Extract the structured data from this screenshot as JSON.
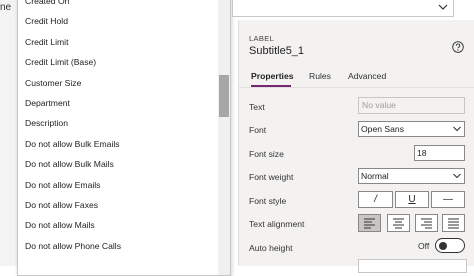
{
  "canvas": {
    "label_fragment": "ne"
  },
  "field_list": {
    "items": [
      "Created On",
      "Credit Hold",
      "Credit Limit",
      "Credit Limit (Base)",
      "Customer Size",
      "Department",
      "Description",
      "Do not allow Bulk Emails",
      "Do not allow Bulk Mails",
      "Do not allow Emails",
      "Do not allow Faxes",
      "Do not allow Mails",
      "Do not allow Phone Calls"
    ]
  },
  "panel": {
    "control_type": "LABEL",
    "control_name": "Subtitle5_1",
    "help_icon": "question-circle-icon",
    "tabs": [
      "Properties",
      "Rules",
      "Advanced"
    ],
    "active_tab": "Properties",
    "accent_color": "#742774",
    "properties": {
      "text": {
        "label": "Text",
        "placeholder": "No value"
      },
      "font": {
        "label": "Font",
        "value": "Open Sans"
      },
      "font_size": {
        "label": "Font size",
        "value": "18"
      },
      "font_weight": {
        "label": "Font weight",
        "value": "Normal"
      },
      "font_style": {
        "label": "Font style",
        "buttons": [
          "/",
          "U",
          "—"
        ]
      },
      "text_alignment": {
        "label": "Text alignment",
        "selected": "left",
        "options": [
          "left",
          "center",
          "right",
          "justify"
        ]
      },
      "auto_height": {
        "label": "Auto height",
        "toggle_label": "Off",
        "on": false
      }
    }
  }
}
